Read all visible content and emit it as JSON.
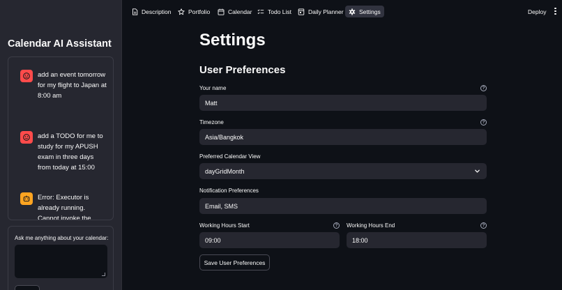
{
  "sidebar": {
    "title": "Calendar AI Assistant",
    "messages": [
      {
        "role": "user",
        "text": "add an event tomorrow for my flight to Japan at 8:00 am"
      },
      {
        "role": "user",
        "text": "add a TODO for me to study for my APUSH exam in three days from today at 15:00"
      },
      {
        "role": "assistant",
        "text": "Error: Executor is already running. Cannot invoke the same"
      }
    ],
    "input_label": "Ask me anything about your calendar:"
  },
  "nav": {
    "items": [
      {
        "label": "Description",
        "icon": "document-icon"
      },
      {
        "label": "Portfolio",
        "icon": "star-icon"
      },
      {
        "label": "Calendar",
        "icon": "calendar-icon"
      },
      {
        "label": "Todo List",
        "icon": "checklist-icon"
      },
      {
        "label": "Daily Planner",
        "icon": "planner-icon"
      },
      {
        "label": "Settings",
        "icon": "gear-icon",
        "active": true
      }
    ],
    "deploy": "Deploy"
  },
  "main": {
    "title": "Settings",
    "section": "User Preferences",
    "fields": {
      "name": {
        "label": "Your name",
        "value": "Matt"
      },
      "timezone": {
        "label": "Timezone",
        "value": "Asia/Bangkok"
      },
      "calendar_view": {
        "label": "Preferred Calendar View",
        "value": "dayGridMonth"
      },
      "notifications": {
        "label": "Notification Preferences",
        "value": "Email, SMS"
      },
      "hours_start": {
        "label": "Working Hours Start",
        "value": "09:00"
      },
      "hours_end": {
        "label": "Working Hours End",
        "value": "18:00"
      }
    },
    "help_glyph": "?",
    "save_label": "Save User Preferences"
  },
  "colors": {
    "background": "#0e1117",
    "sidebar": "#262730",
    "input": "#262730",
    "user_avatar": "#ff4b4b",
    "assistant_avatar": "#ffa421",
    "text": "#fafafa"
  }
}
